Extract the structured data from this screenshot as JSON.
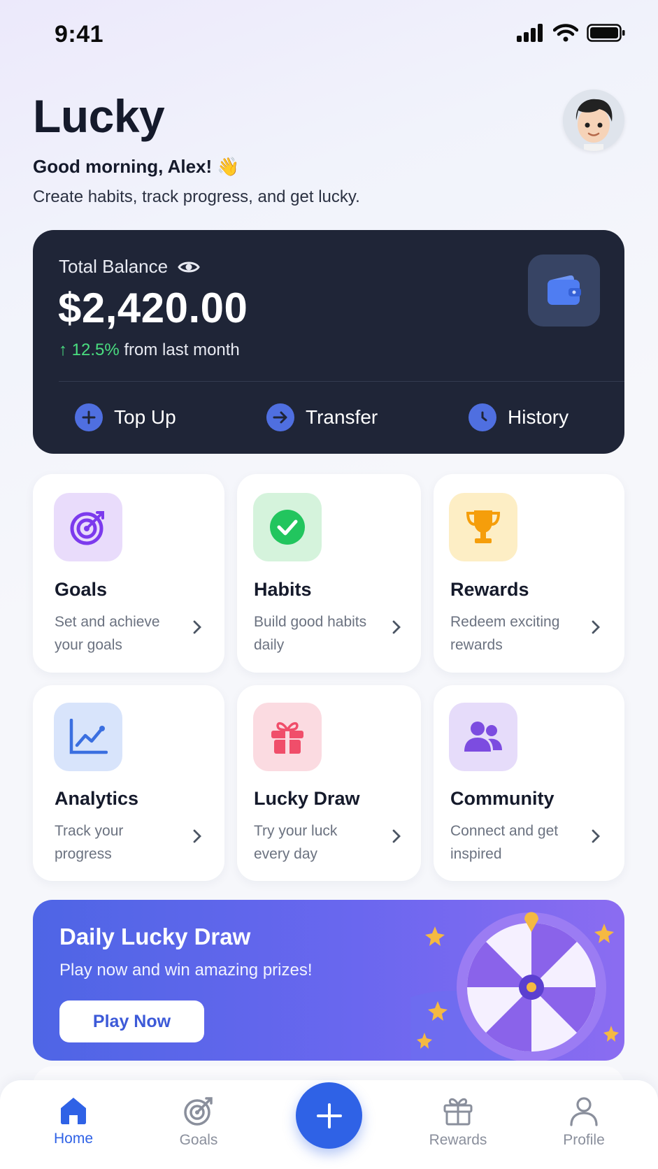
{
  "status_bar": {
    "time": "9:41"
  },
  "header": {
    "title": "Lucky",
    "greeting": "Good morning, Alex! 👋",
    "subtitle": "Create habits, track progress, and get lucky."
  },
  "balance": {
    "label": "Total Balance",
    "amount": "$2,420.00",
    "change_pct": "↑ 12.5%",
    "change_text": "from last month",
    "actions": [
      {
        "label": "Top Up",
        "icon": "plus-icon"
      },
      {
        "label": "Transfer",
        "icon": "arrow-right-icon"
      },
      {
        "label": "History",
        "icon": "clock-icon"
      }
    ]
  },
  "features": [
    {
      "title": "Goals",
      "desc": "Set and achieve your goals",
      "icon": "target-icon",
      "color": "#7c3aed"
    },
    {
      "title": "Habits",
      "desc": "Build good habits daily",
      "icon": "check-circle-icon",
      "color": "#22c55e"
    },
    {
      "title": "Rewards",
      "desc": "Redeem exciting rewards",
      "icon": "trophy-icon",
      "color": "#f59e0b"
    },
    {
      "title": "Analytics",
      "desc": "Track your progress",
      "icon": "chart-line-icon",
      "color": "#3b6fe0"
    },
    {
      "title": "Lucky Draw",
      "desc": "Try your luck every day",
      "icon": "gift-icon",
      "color": "#f04e6a"
    },
    {
      "title": "Community",
      "desc": "Connect and get inspired",
      "icon": "users-icon",
      "color": "#7c4ce0"
    }
  ],
  "promo": {
    "title": "Daily Lucky Draw",
    "subtitle": "Play now and win amazing prizes!",
    "button": "Play Now"
  },
  "nav": {
    "items": [
      {
        "label": "Home",
        "icon": "home-icon",
        "active": true
      },
      {
        "label": "Goals",
        "icon": "target-icon",
        "active": false
      },
      {
        "label": "Rewards",
        "icon": "gift-icon",
        "active": false
      },
      {
        "label": "Profile",
        "icon": "user-icon",
        "active": false
      }
    ],
    "fab_icon": "plus-icon"
  },
  "colors": {
    "accent": "#2f62e6",
    "card_dark": "#1f2537",
    "positive": "#4ade80"
  }
}
